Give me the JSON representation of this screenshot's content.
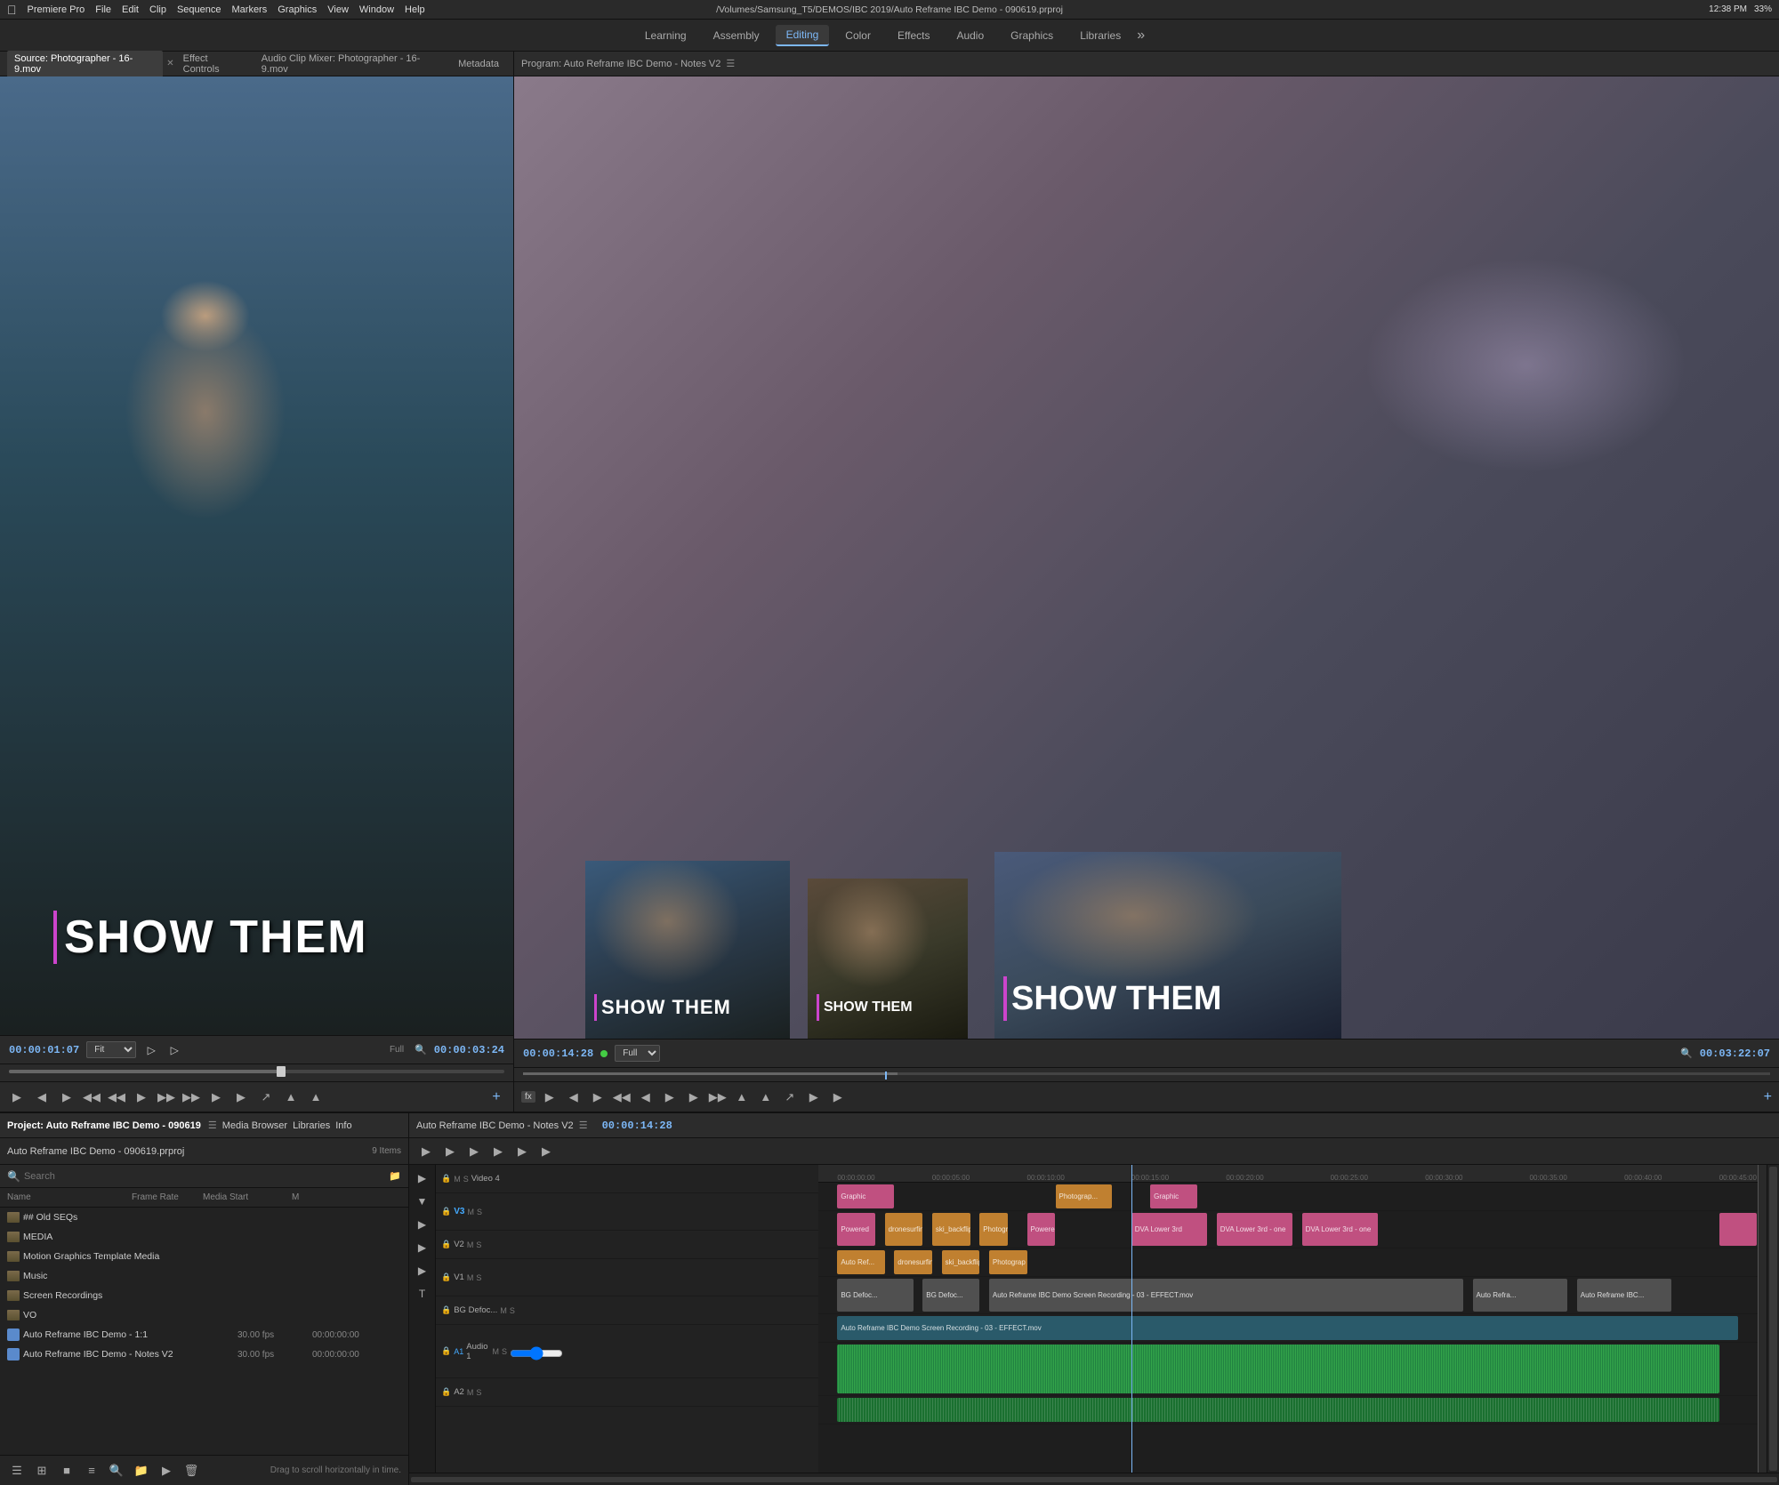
{
  "menubar": {
    "app_name": "Premiere Pro",
    "menus": [
      "File",
      "Edit",
      "Clip",
      "Sequence",
      "Markers",
      "Graphics",
      "View",
      "Window",
      "Help"
    ],
    "title": "/Volumes/Samsung_T5/DEMOS/IBC 2019/Auto Reframe IBC Demo - 090619.prproj",
    "time": "12:38 PM",
    "battery": "33%"
  },
  "topbar": {
    "tabs": [
      "Learning",
      "Assembly",
      "Editing",
      "Color",
      "Effects",
      "Audio",
      "Graphics",
      "Libraries"
    ],
    "active": "Editing",
    "more": "»"
  },
  "source_panel": {
    "tabs": [
      "Source: Photographer - 16-9.mov",
      "Effect Controls",
      "Audio Clip Mixer: Photographer - 16-9.mov",
      "Metadata"
    ],
    "active_tab": "Source: Photographer - 16-9.mov",
    "big_text": "SHOW THEM",
    "timecode": "00:00:01:07",
    "duration": "00:00:03:24",
    "fit_label": "Fit",
    "full_label": "Full"
  },
  "program_panel": {
    "title": "Program: Auto Reframe IBC Demo - Notes V2",
    "timecode": "00:00:14:28",
    "duration": "00:03:22:07",
    "fit_label": "Full",
    "thumb_texts": [
      "SHOW THEM",
      "SHOW THEM",
      "SHOW THEM"
    ]
  },
  "project_panel": {
    "tabs": [
      "Project: Auto Reframe IBC Demo - 090619",
      "Media Browser",
      "Libraries",
      "Info"
    ],
    "active_tab": "Project: Auto Reframe IBC Demo - 090619",
    "project_file": "Auto Reframe IBC Demo - 090619.prproj",
    "item_count": "9 Items",
    "columns": [
      "Name",
      "Frame Rate",
      "Media Start",
      "M"
    ],
    "items": [
      {
        "name": "## Old SEQs",
        "type": "folder",
        "color": "#888",
        "fps": "",
        "start": ""
      },
      {
        "name": "MEDIA",
        "type": "folder",
        "color": "#888",
        "fps": "",
        "start": ""
      },
      {
        "name": "Motion Graphics Template Media",
        "type": "folder",
        "color": "#888",
        "fps": "",
        "start": ""
      },
      {
        "name": "Music",
        "type": "folder",
        "color": "#888",
        "fps": "",
        "start": ""
      },
      {
        "name": "Screen Recordings",
        "type": "folder",
        "color": "#888",
        "fps": "",
        "start": ""
      },
      {
        "name": "VO",
        "type": "folder",
        "color": "#888",
        "fps": "",
        "start": ""
      },
      {
        "name": "Auto Reframe IBC Demo - 1:1",
        "type": "sequence",
        "color": "#5a8acc",
        "fps": "30.00 fps",
        "start": "00:00:00:00"
      },
      {
        "name": "Auto Reframe IBC Demo - Notes V2",
        "type": "sequence",
        "color": "#5a8acc",
        "fps": "30.00 fps",
        "start": "00:00:00:00"
      }
    ],
    "footer_note": "Drag to scroll horizontally in time."
  },
  "timeline": {
    "tab": "Auto Reframe IBC Demo - Notes V2",
    "timecode": "00:00:14:28",
    "tracks": [
      {
        "id": "V4",
        "label": "Video 4",
        "type": "video"
      },
      {
        "id": "V3",
        "label": "V3",
        "type": "video"
      },
      {
        "id": "V2",
        "label": "V2",
        "type": "video"
      },
      {
        "id": "V1",
        "label": "V1",
        "type": "video"
      },
      {
        "id": "BG",
        "label": "BG",
        "type": "video"
      },
      {
        "id": "A1",
        "label": "Audio 1",
        "type": "audio"
      },
      {
        "id": "A2",
        "label": "A2",
        "type": "audio"
      }
    ],
    "ruler_marks": [
      "00:00:00:00",
      "00:00:05:00",
      "00:00:10:00",
      "00:00:15:00",
      "00:00:20:00",
      "00:00:25:00",
      "00:00:30:00",
      "00:00:35:00",
      "00:00:40:00",
      "00:00:45:00"
    ],
    "clips": {
      "V4": [
        {
          "label": "Graphic",
          "color": "pink",
          "left": "2%",
          "width": "7%"
        },
        {
          "label": "Photograp...",
          "color": "orange",
          "left": "25%",
          "width": "6%"
        },
        {
          "label": "Graphic",
          "color": "pink",
          "left": "35%",
          "width": "5%"
        }
      ],
      "V3": [
        {
          "label": "Powered",
          "color": "pink",
          "left": "2%",
          "width": "4%"
        },
        {
          "label": "dronesurfing_f",
          "color": "orange",
          "left": "7%",
          "width": "5%"
        },
        {
          "label": "ski_backflip_sma",
          "color": "orange",
          "left": "13%",
          "width": "5%"
        },
        {
          "label": "Photograp",
          "color": "orange",
          "left": "19%",
          "width": "4%"
        },
        {
          "label": "Powered",
          "color": "pink",
          "left": "24%",
          "width": "4%"
        },
        {
          "label": "DVA Lower 3rd",
          "color": "pink",
          "left": "33%",
          "width": "8%"
        },
        {
          "label": "DVA Lower 3rd - one",
          "color": "pink",
          "left": "42%",
          "width": "8%"
        },
        {
          "label": "DVA Lower 3rd - one",
          "color": "pink",
          "left": "51%",
          "width": "8%"
        },
        {
          "label": "",
          "color": "pink",
          "left": "95%",
          "width": "4%"
        }
      ]
    }
  },
  "icons": {
    "folder": "📁",
    "sequence": "🎬",
    "search": "🔍",
    "play": "▶",
    "pause": "⏸",
    "rewind": "⏮",
    "forward": "⏭",
    "step_back": "⏪",
    "step_fwd": "⏩",
    "add": "+",
    "lock": "🔒",
    "eye": "👁",
    "scissors": "✂",
    "marker": "◆",
    "wrench": "⚙",
    "export": "↗",
    "list": "≡",
    "grid": "⊞",
    "film": "🎞",
    "arrow_right": "▶",
    "chevron": "›",
    "menu": "≡"
  }
}
